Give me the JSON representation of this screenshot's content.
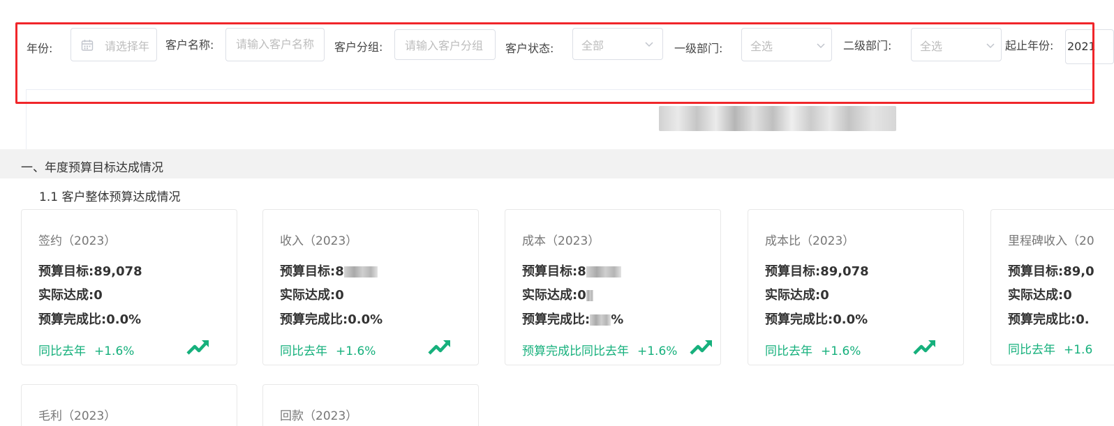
{
  "filters": {
    "year_label": "年份:",
    "year_placeholder": "请选择年",
    "customer_name_label": "客户名称:",
    "customer_name_placeholder": "请输入客户名称",
    "customer_group_label": "客户分组:",
    "customer_group_placeholder": "请输入客户分组",
    "customer_status_label": "客户状态:",
    "customer_status_value": "全部",
    "dept1_label": "一级部门:",
    "dept1_value": "全选",
    "dept2_label": "二级部门:",
    "dept2_value": "全选",
    "range_label": "起止年份:",
    "range_value": "2021"
  },
  "section": {
    "title": "一、年度预算目标达成情况",
    "subtitle": "1.1 客户整体预算达成情况"
  },
  "labels": {
    "budget_target": "预算目标:",
    "actual": "实际达成:",
    "completion": "预算完成比:"
  },
  "cards": [
    {
      "title": "签约（2023）",
      "budget": "89,078",
      "actual": "0",
      "completion": "0.0%",
      "trend_label": "同比去年",
      "trend_value": "+1.6%"
    },
    {
      "title": "收入（2023）",
      "budget": "8",
      "actual": "0",
      "completion": "0.0%",
      "trend_label": "同比去年",
      "trend_value": "+1.6%"
    },
    {
      "title": "成本（2023）",
      "budget": "8",
      "actual": "0",
      "completion": "%",
      "trend_label": "预算完成比同比去年",
      "trend_value": "+1.6%"
    },
    {
      "title": "成本比（2023）",
      "budget": "89,078",
      "actual": "0",
      "completion": "0.0%",
      "trend_label": "同比去年",
      "trend_value": "+1.6%"
    },
    {
      "title": "里程碑收入（20",
      "budget": "89,0",
      "actual": "0",
      "completion": "0.",
      "trend_label": "同比去年",
      "trend_value": "+1.6"
    },
    {
      "title": "毛利（2023）"
    },
    {
      "title": "回款（2023）"
    }
  ],
  "colors": {
    "highlight": "#f0262a",
    "trend_green": "#16b07c"
  },
  "icons": {
    "calendar": "calendar-icon",
    "chevron": "chevron-down-icon",
    "trend": "trend-up-icon"
  }
}
